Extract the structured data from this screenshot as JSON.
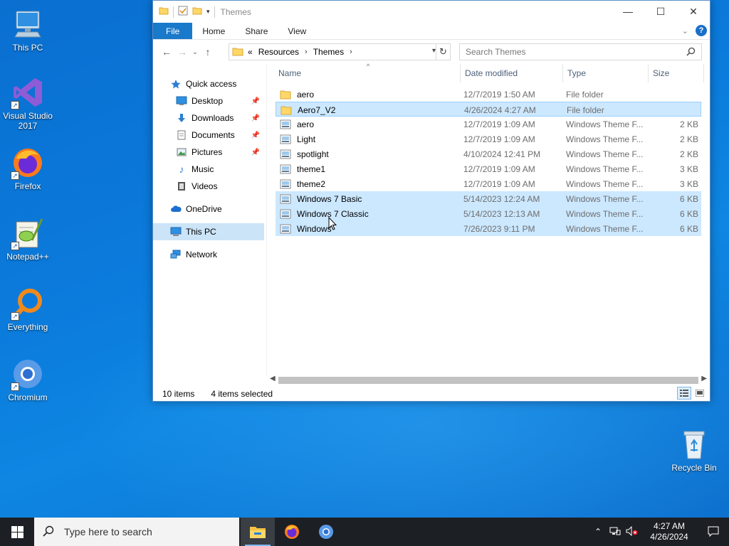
{
  "desktop": {
    "icons": [
      {
        "label": "This PC"
      },
      {
        "label": "Visual Studio 2017"
      },
      {
        "label": "Firefox"
      },
      {
        "label": "Notepad++"
      },
      {
        "label": "Everything"
      },
      {
        "label": "Chromium"
      },
      {
        "label": "Recycle Bin"
      }
    ]
  },
  "window": {
    "title": "Themes",
    "controls": {
      "minimize": "—",
      "maximize": "☐",
      "close": "✕"
    }
  },
  "ribbon": {
    "tabs": [
      "File",
      "Home",
      "Share",
      "View"
    ],
    "help": "?"
  },
  "address": {
    "overflow": "«",
    "crumbs": [
      "Resources",
      "Themes"
    ]
  },
  "search": {
    "placeholder": "Search Themes"
  },
  "navpane": {
    "items": [
      {
        "label": "Quick access"
      },
      {
        "label": "Desktop"
      },
      {
        "label": "Downloads"
      },
      {
        "label": "Documents"
      },
      {
        "label": "Pictures"
      },
      {
        "label": "Music"
      },
      {
        "label": "Videos"
      },
      {
        "label": "OneDrive"
      },
      {
        "label": "This PC"
      },
      {
        "label": "Network"
      }
    ]
  },
  "columns": {
    "name": "Name",
    "date": "Date modified",
    "type": "Type",
    "size": "Size"
  },
  "files": [
    {
      "name": "aero",
      "date": "12/7/2019 1:50 AM",
      "type": "File folder",
      "size": ""
    },
    {
      "name": "Aero7_V2",
      "date": "4/26/2024 4:27 AM",
      "type": "File folder",
      "size": ""
    },
    {
      "name": "aero",
      "date": "12/7/2019 1:09 AM",
      "type": "Windows Theme F...",
      "size": "2 KB"
    },
    {
      "name": "Light",
      "date": "12/7/2019 1:09 AM",
      "type": "Windows Theme F...",
      "size": "2 KB"
    },
    {
      "name": "spotlight",
      "date": "4/10/2024 12:41 PM",
      "type": "Windows Theme F...",
      "size": "2 KB"
    },
    {
      "name": "theme1",
      "date": "12/7/2019 1:09 AM",
      "type": "Windows Theme F...",
      "size": "3 KB"
    },
    {
      "name": "theme2",
      "date": "12/7/2019 1:09 AM",
      "type": "Windows Theme F...",
      "size": "3 KB"
    },
    {
      "name": "Windows 7 Basic",
      "date": "5/14/2023 12:24 AM",
      "type": "Windows Theme F...",
      "size": "6 KB"
    },
    {
      "name": "Windows 7 Classic",
      "date": "5/14/2023 12:13 AM",
      "type": "Windows Theme F...",
      "size": "6 KB"
    },
    {
      "name": "Windows",
      "date": "7/26/2023 9:11 PM",
      "type": "Windows Theme F...",
      "size": "6 KB"
    }
  ],
  "status": {
    "count": "10 items",
    "selected": "4 items selected"
  },
  "taskbar": {
    "search_placeholder": "Type here to search",
    "time": "4:27 AM",
    "date": "4/26/2024"
  }
}
